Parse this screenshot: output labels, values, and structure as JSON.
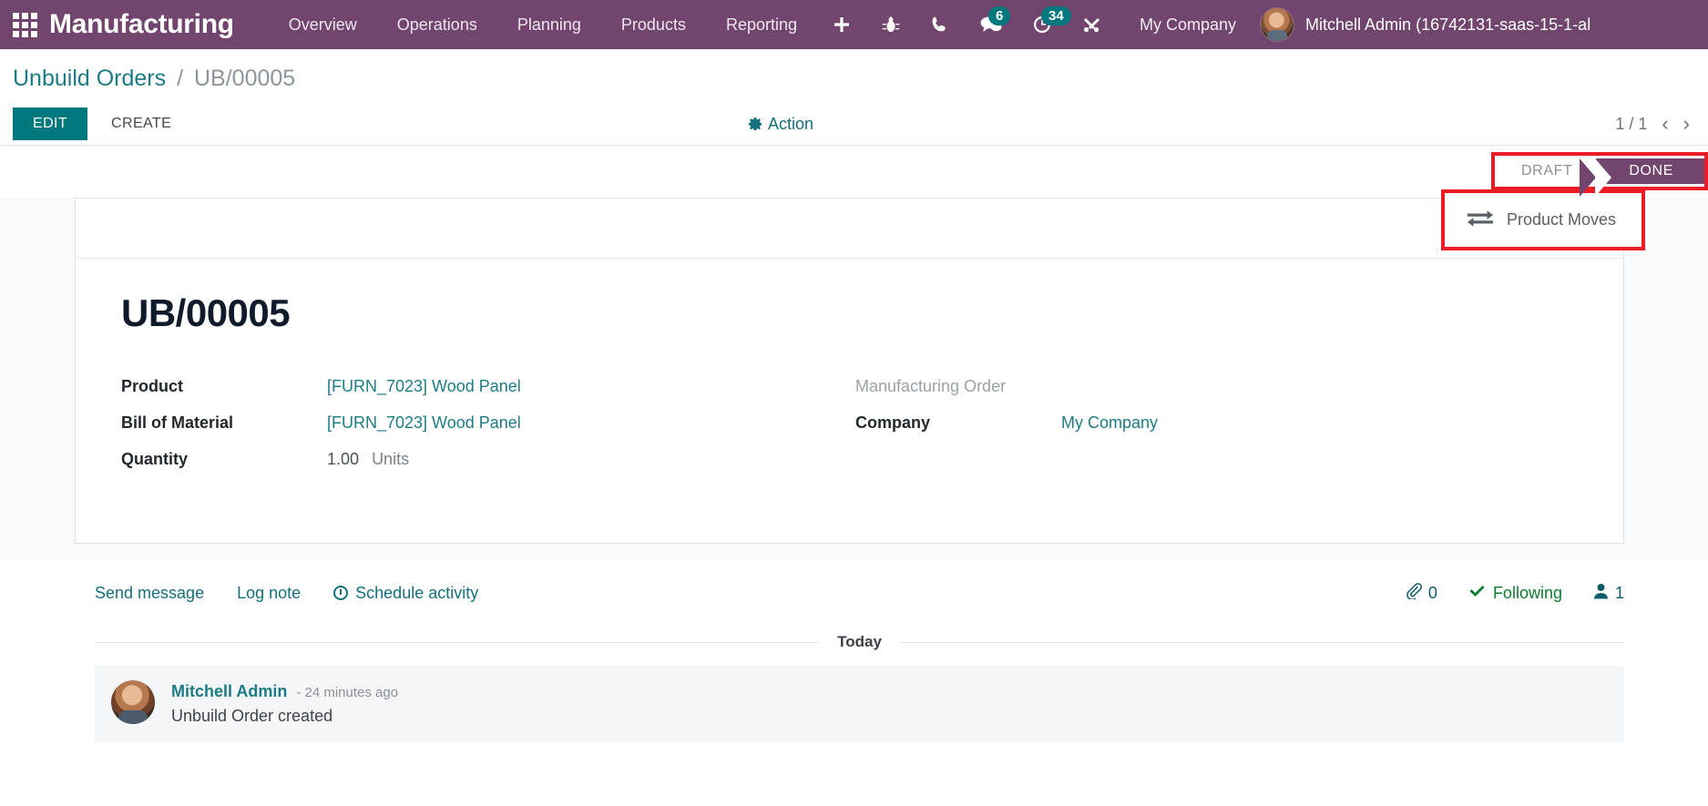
{
  "navbar": {
    "apps_icon": "apps-grid-icon",
    "brand": "Manufacturing",
    "menus": [
      {
        "label": "Overview"
      },
      {
        "label": "Operations"
      },
      {
        "label": "Planning"
      },
      {
        "label": "Products"
      },
      {
        "label": "Reporting"
      }
    ],
    "icons": [
      {
        "name": "plus-icon",
        "glyph": "+"
      },
      {
        "name": "bug-icon",
        "glyph": "bug"
      },
      {
        "name": "phone-icon",
        "glyph": "phone"
      },
      {
        "name": "messages-icon",
        "glyph": "chat",
        "badge": "6"
      },
      {
        "name": "activities-icon",
        "glyph": "clock",
        "badge": "34"
      },
      {
        "name": "tools-icon",
        "glyph": "tools"
      }
    ],
    "company": "My Company",
    "user": "Mitchell Admin (16742131-saas-15-1-al",
    "accent": "#71456e",
    "badge_color": "#00787d"
  },
  "breadcrumb": {
    "parent": "Unbuild Orders",
    "separator": "/",
    "current": "UB/00005"
  },
  "controls": {
    "edit": "EDIT",
    "create": "CREATE",
    "action": "Action",
    "pager_value": "1 / 1",
    "prev_arrow": "‹",
    "next_arrow": "›"
  },
  "statusbar": {
    "stages": [
      {
        "label": "DRAFT",
        "active": false
      },
      {
        "label": "DONE",
        "active": true
      }
    ],
    "highlight_color": "#ec1c24"
  },
  "smart_buttons": [
    {
      "label": "Product Moves",
      "icon": "exchange-arrows-icon",
      "highlighted": true
    }
  ],
  "form": {
    "title": "UB/00005",
    "left_fields": [
      {
        "label": "Product",
        "value": "[FURN_7023] Wood Panel",
        "type": "link"
      },
      {
        "label": "Bill of Material",
        "value": "[FURN_7023] Wood Panel",
        "type": "link"
      },
      {
        "label": "Quantity",
        "value": "1.00",
        "unit": "Units",
        "type": "qty"
      }
    ],
    "right_fields": [
      {
        "label": "Manufacturing Order",
        "value": "",
        "type": "empty"
      },
      {
        "label": "Company",
        "value": "My Company",
        "type": "link"
      }
    ]
  },
  "chatter": {
    "send_message": "Send message",
    "log_note": "Log note",
    "schedule_activity": "Schedule activity",
    "attachment_count": "0",
    "following": "Following",
    "follower_count": "1",
    "day_separator": "Today",
    "messages": [
      {
        "author": "Mitchell Admin",
        "time": "- 24 minutes ago",
        "text": "Unbuild Order created"
      }
    ]
  }
}
